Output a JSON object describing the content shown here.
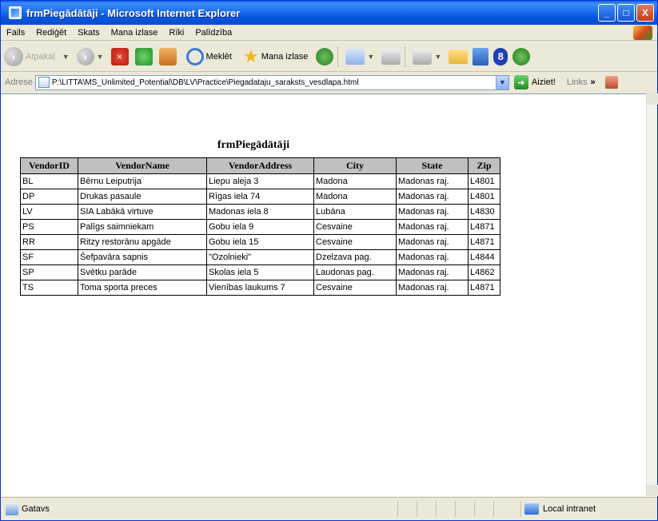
{
  "window": {
    "title": "frmPiegādātāji - Microsoft Internet Explorer",
    "controls": {
      "minimize": "_",
      "maximize": "□",
      "close": "X"
    }
  },
  "menu": [
    "Fails",
    "Rediģēt",
    "Skats",
    "Mana izlase",
    "Rīki",
    "Palīdzība"
  ],
  "toolbar": {
    "back_label": "Atpakaļ",
    "search_label": "Meklēt",
    "favorites_label": "Mana izlase",
    "stop_glyph": "×",
    "blue_badge": "8"
  },
  "address": {
    "label": "Adrese",
    "url": "P:\\LITTA\\MS_Unlimited_Potential\\DB\\LV\\Practice\\Piegadataju_saraksts_vesdlapa.html",
    "go_label": "Aiziet!",
    "links_label": "Links",
    "chevron": "»"
  },
  "page": {
    "title": "frmPiegādātāji",
    "columns": [
      "VendorID",
      "VendorName",
      "VendorAddress",
      "City",
      "State",
      "Zip"
    ],
    "rows": [
      [
        "BL",
        "Bērnu Leiputrija",
        "Liepu aleja 3",
        "Madona",
        "Madonas raj.",
        "L4801"
      ],
      [
        "DP",
        "Drukas pasaule",
        "Rīgas iela 74",
        "Madona",
        "Madonas raj.",
        "L4801"
      ],
      [
        "LV",
        "SIA Labākā virtuve",
        "Madonas iela 8",
        "Lubāna",
        "Madonas raj.",
        "L4830"
      ],
      [
        "PS",
        "Palīgs saimniekam",
        "Gobu iela 9",
        "Cesvaine",
        "Madonas raj.",
        "L4871"
      ],
      [
        "RR",
        "Ritzy restorānu apgāde",
        "Gobu iela 15",
        "Cesvaine",
        "Madonas raj.",
        "L4871"
      ],
      [
        "SF",
        "Šefpavāra sapnis",
        "\"Ozolnieki\"",
        "Dzelzava pag.",
        "Madonas raj.",
        "L4844"
      ],
      [
        "SP",
        "Svētku parāde",
        "Skolas iela 5",
        "Laudonas pag.",
        "Madonas raj.",
        "L4862"
      ],
      [
        "TS",
        "Toma sporta preces",
        "Vienības laukums 7",
        "Cesvaine",
        "Madonas raj.",
        "L4871"
      ]
    ]
  },
  "status": {
    "text": "Gatavs",
    "zone": "Local intranet"
  }
}
